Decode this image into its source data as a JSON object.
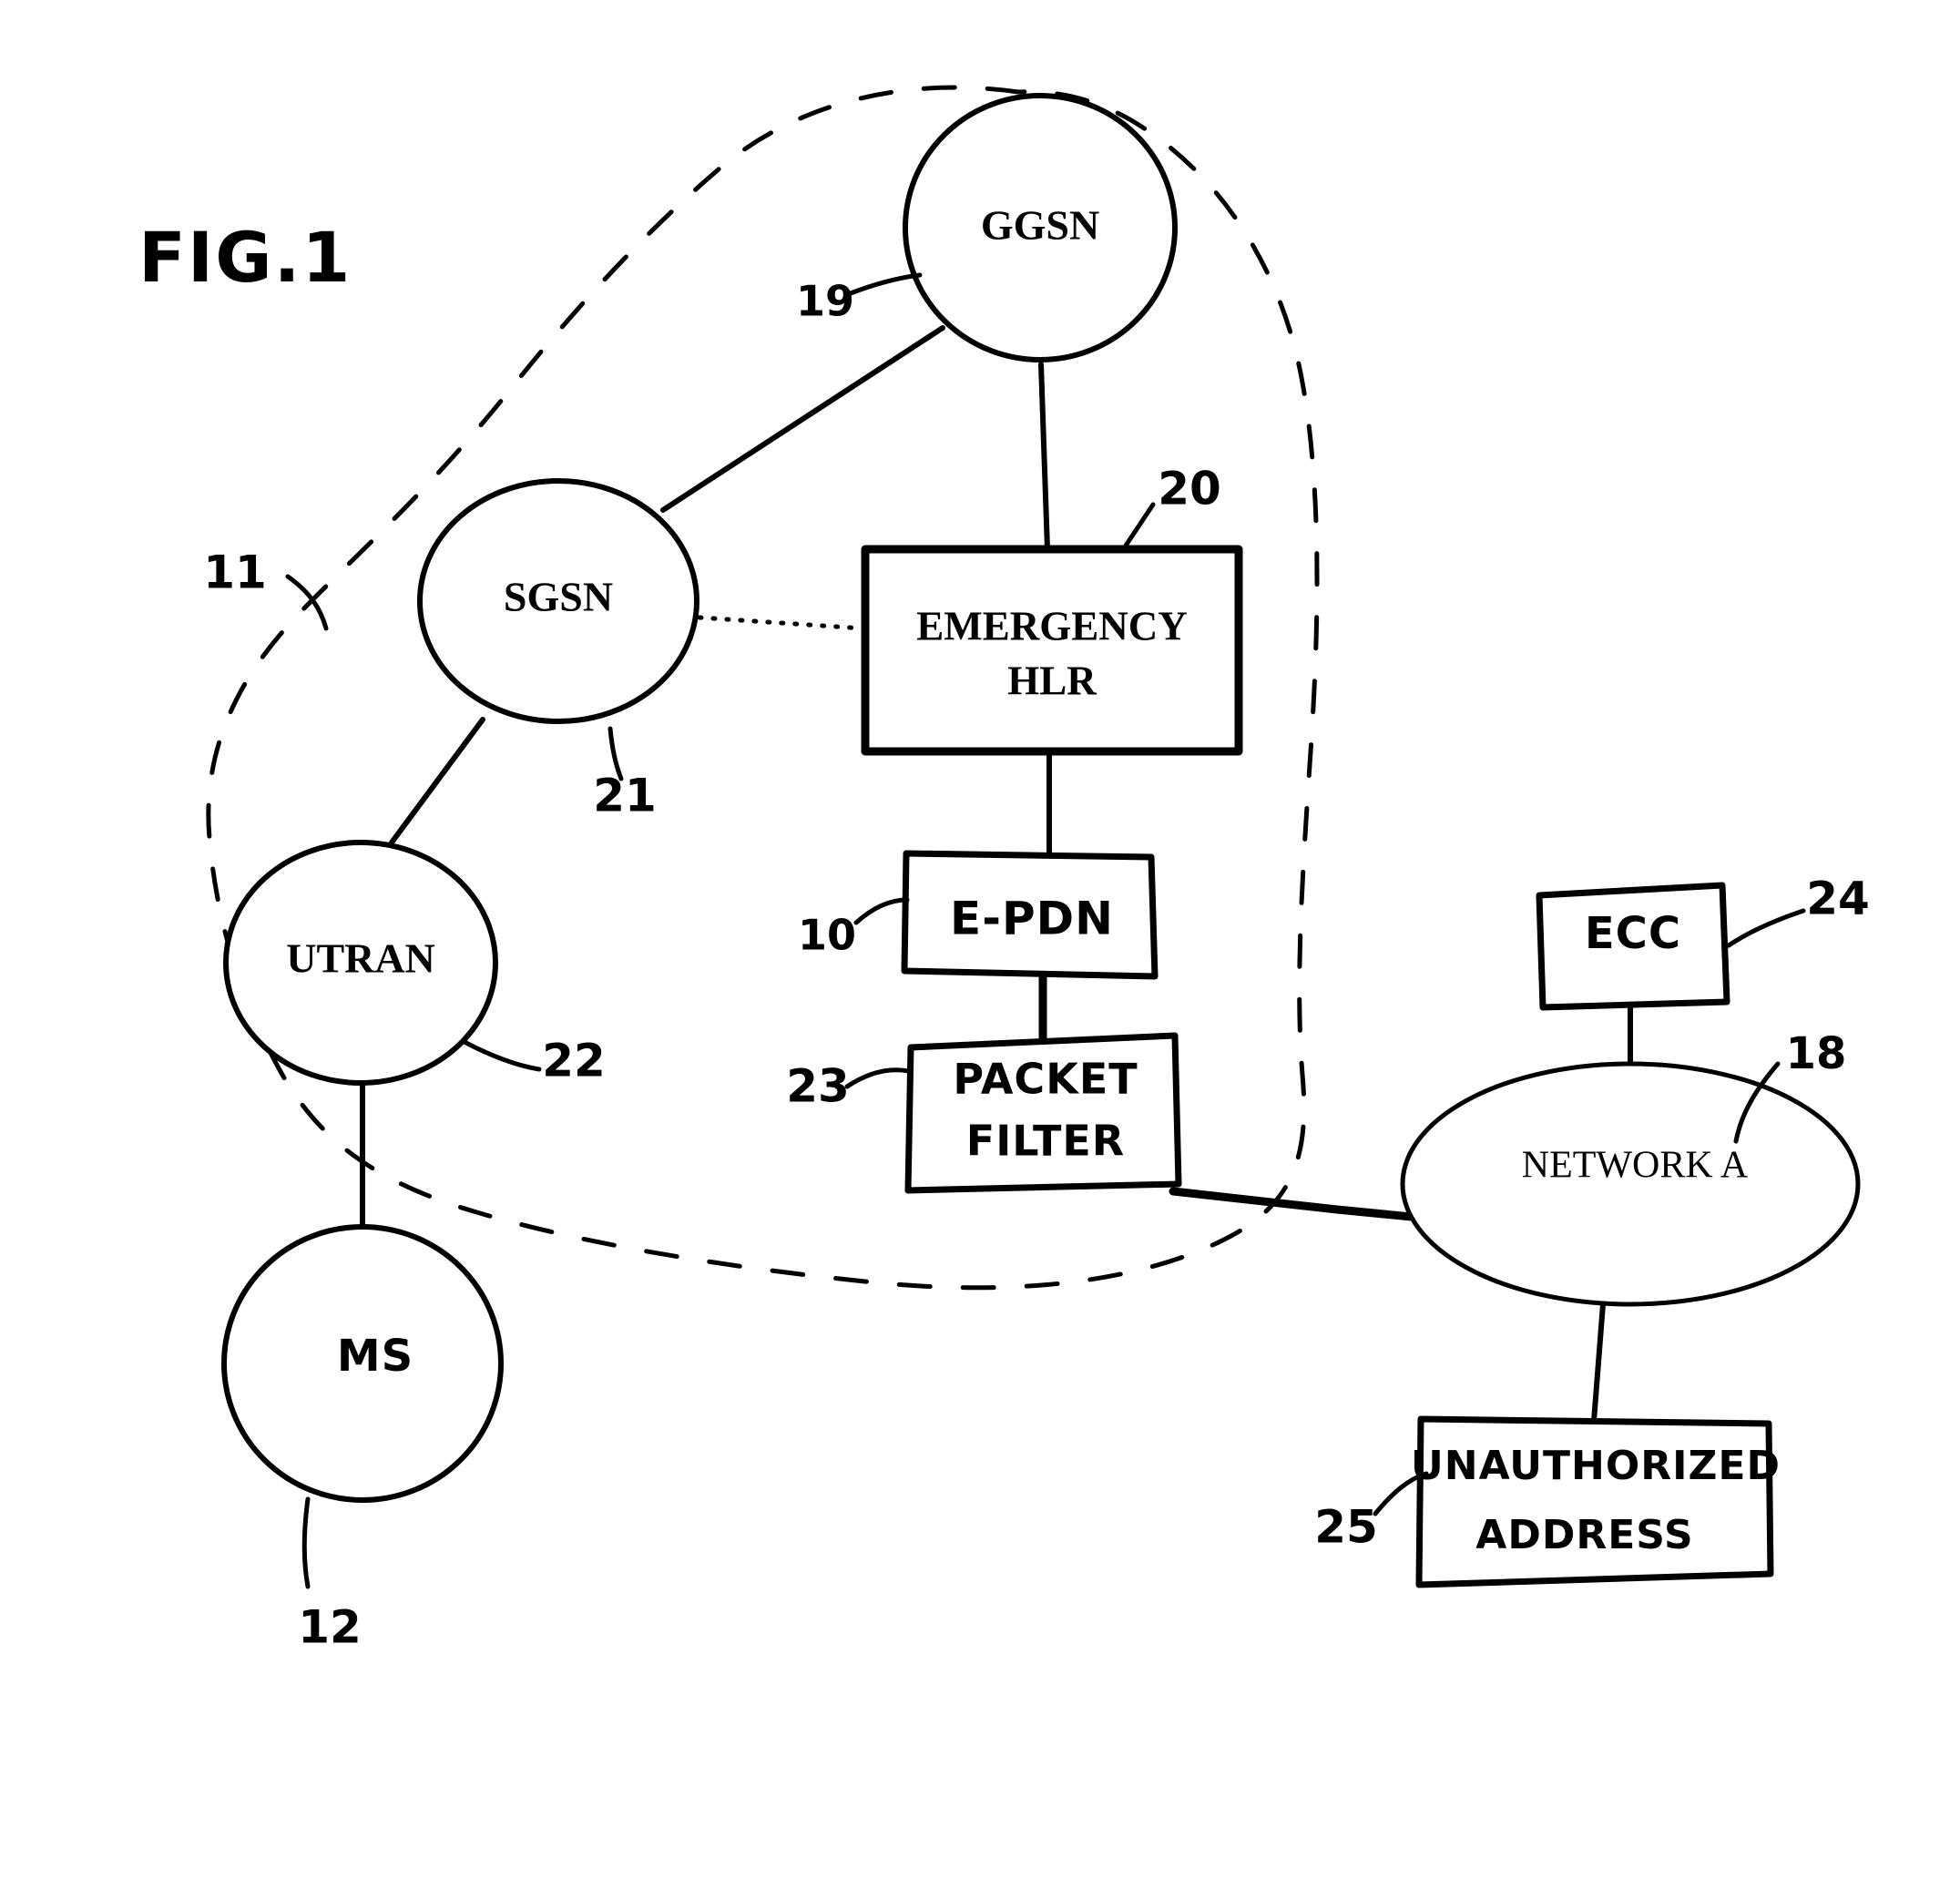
{
  "figure": {
    "title": "FIG.1",
    "style": "patent-line-drawing",
    "ink_color": "#000000",
    "background_color": "#ffffff"
  },
  "nodes": {
    "ggsn": {
      "label": "GGSN",
      "shape": "circle"
    },
    "sgsn": {
      "label": "SGSN",
      "shape": "ellipse"
    },
    "utran": {
      "label": "UTRAN",
      "shape": "ellipse"
    },
    "ms": {
      "label": "MS",
      "shape": "circle"
    },
    "emergency_hlr": {
      "label_line1": "EMERGENCY",
      "label_line2": "HLR",
      "shape": "rectangle"
    },
    "e_pdn": {
      "label": "E-PDN",
      "shape": "rectangle"
    },
    "packet_filter": {
      "label_line1": "PACKET",
      "label_line2": "FILTER",
      "shape": "rectangle"
    },
    "ecc": {
      "label": "ECC",
      "shape": "rectangle"
    },
    "network_a": {
      "label": "NETWORK A",
      "shape": "ellipse"
    },
    "unauthorized_address": {
      "label_line1": "UNAUTHORIZED",
      "label_line2": "ADDRESS",
      "shape": "rectangle"
    }
  },
  "reference_numerals": {
    "boundary": "11",
    "ms": "12",
    "e_pdn": "10",
    "network_a": "18",
    "ggsn": "19",
    "emergency_hlr": "20",
    "sgsn": "21",
    "utran": "22",
    "packet_filter": "23",
    "ecc": "24",
    "unauthorized_address": "25"
  },
  "connections": [
    {
      "from": "sgsn",
      "to": "ggsn",
      "style": "solid"
    },
    {
      "from": "ggsn",
      "to": "emergency_hlr",
      "style": "solid"
    },
    {
      "from": "sgsn",
      "to": "emergency_hlr",
      "style": "dotted"
    },
    {
      "from": "sgsn",
      "to": "utran",
      "style": "solid"
    },
    {
      "from": "utran",
      "to": "ms",
      "style": "solid"
    },
    {
      "from": "emergency_hlr",
      "to": "e_pdn",
      "style": "solid"
    },
    {
      "from": "e_pdn",
      "to": "packet_filter",
      "style": "solid"
    },
    {
      "from": "packet_filter",
      "to": "network_a",
      "style": "solid"
    },
    {
      "from": "ecc",
      "to": "network_a",
      "style": "solid"
    },
    {
      "from": "network_a",
      "to": "unauthorized_address",
      "style": "solid"
    }
  ],
  "boundary_region": {
    "style": "dashed",
    "contains": [
      "ggsn",
      "sgsn",
      "utran",
      "emergency_hlr",
      "e_pdn",
      "packet_filter"
    ]
  }
}
